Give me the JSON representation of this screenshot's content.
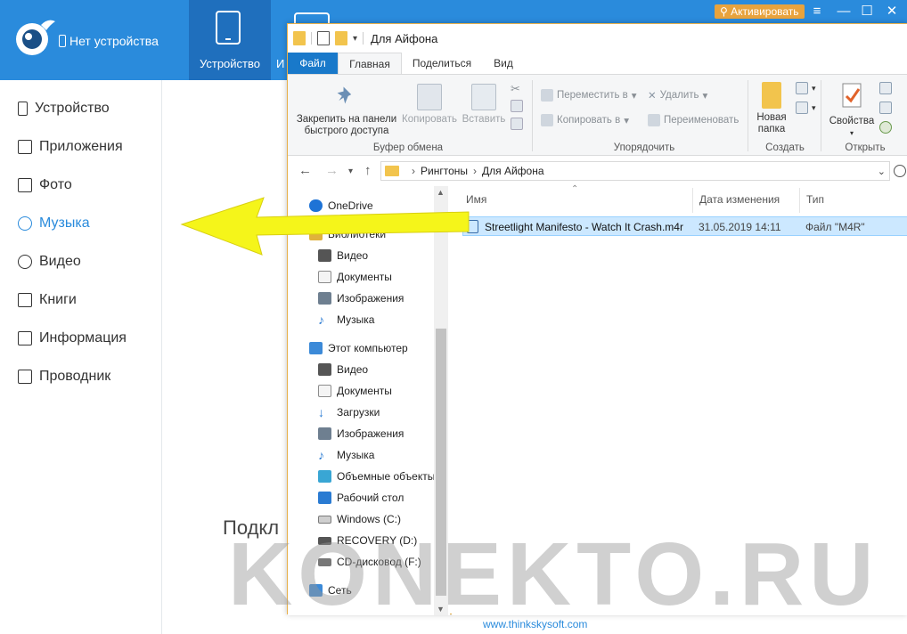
{
  "app": {
    "device_status": "Нет устройства",
    "tab_device": "Устройство",
    "tab_partial": "И",
    "activate_label": "Активировать",
    "window_controls": {
      "minimize": "—",
      "maximize": "☐",
      "close": "✕"
    },
    "sidebar": [
      {
        "label": "Устройство",
        "icon": "phone-icon"
      },
      {
        "label": "Приложения",
        "icon": "apps-icon"
      },
      {
        "label": "Фото",
        "icon": "photo-icon"
      },
      {
        "label": "Музыка",
        "icon": "music-icon",
        "active": true
      },
      {
        "label": "Видео",
        "icon": "video-icon"
      },
      {
        "label": "Книги",
        "icon": "book-icon"
      },
      {
        "label": "Информация",
        "icon": "info-icon"
      },
      {
        "label": "Проводник",
        "icon": "folder-icon"
      }
    ],
    "connect_text": "Подкл",
    "footer_link": "www.thinkskysoft.com",
    "colors": {
      "header": "#2a8bdc",
      "active_tab": "#1f6fbd",
      "accent": "#2a8bdc"
    }
  },
  "explorer": {
    "title": "Для Айфона",
    "tabs": {
      "file": "Файл",
      "home": "Главная",
      "share": "Поделиться",
      "view": "Вид"
    },
    "ribbon": {
      "pin": "Закрепить на панели быстрого доступа",
      "pin_line1": "Закрепить на панели",
      "pin_line2": "быстрого доступа",
      "copy": "Копировать",
      "paste": "Вставить",
      "group_clipboard": "Буфер обмена",
      "move_to": "Переместить в",
      "copy_to": "Копировать в",
      "delete": "Удалить",
      "rename": "Переименовать",
      "group_organize": "Упорядочить",
      "new_folder_line1": "Новая",
      "new_folder_line2": "папка",
      "group_create": "Создать",
      "properties": "Свойства",
      "group_open": "Открыть"
    },
    "address": {
      "root": "Рингтоны",
      "current": "Для Айфона"
    },
    "nav": [
      {
        "label": "OneDrive",
        "level": 0,
        "color": "#1e73d6"
      },
      {
        "label": "Библиотеки",
        "level": 0,
        "color": "#e0b23c"
      },
      {
        "label": "Видео",
        "level": 1,
        "color": "#555555"
      },
      {
        "label": "Документы",
        "level": 1,
        "color": "#8c8c8c"
      },
      {
        "label": "Изображения",
        "level": 1,
        "color": "#6e7f90"
      },
      {
        "label": "Музыка",
        "level": 1,
        "color": "#2a7bd2"
      },
      {
        "label": "Этот компьютер",
        "level": 0,
        "color": "#3c8ad8"
      },
      {
        "label": "Видео",
        "level": 1,
        "color": "#555555"
      },
      {
        "label": "Документы",
        "level": 1,
        "color": "#8c8c8c"
      },
      {
        "label": "Загрузки",
        "level": 1,
        "color": "#2a7bd2"
      },
      {
        "label": "Изображения",
        "level": 1,
        "color": "#6e7f90"
      },
      {
        "label": "Музыка",
        "level": 1,
        "color": "#2a7bd2"
      },
      {
        "label": "Объемные объекты",
        "level": 1,
        "color": "#39a6d4"
      },
      {
        "label": "Рабочий стол",
        "level": 1,
        "color": "#2a7bd2"
      },
      {
        "label": "Windows (C:)",
        "level": 1,
        "color": "#7a7a7a"
      },
      {
        "label": "RECOVERY (D:)",
        "level": 1,
        "color": "#555555"
      },
      {
        "label": "CD-дисковод (F:)",
        "level": 1,
        "color": "#777777"
      },
      {
        "label": "Сеть",
        "level": 0,
        "color": "#3c8ad8"
      }
    ],
    "columns": {
      "name": "Имя",
      "date": "Дата изменения",
      "type": "Тип"
    },
    "files": [
      {
        "name": "Streetlight Manifesto - Watch It Crash.m4r",
        "date": "31.05.2019 14:11",
        "type": "Файл \"M4R\""
      }
    ]
  },
  "watermark": "KONEKTO.RU",
  "arrow_color": "#f5f51a"
}
